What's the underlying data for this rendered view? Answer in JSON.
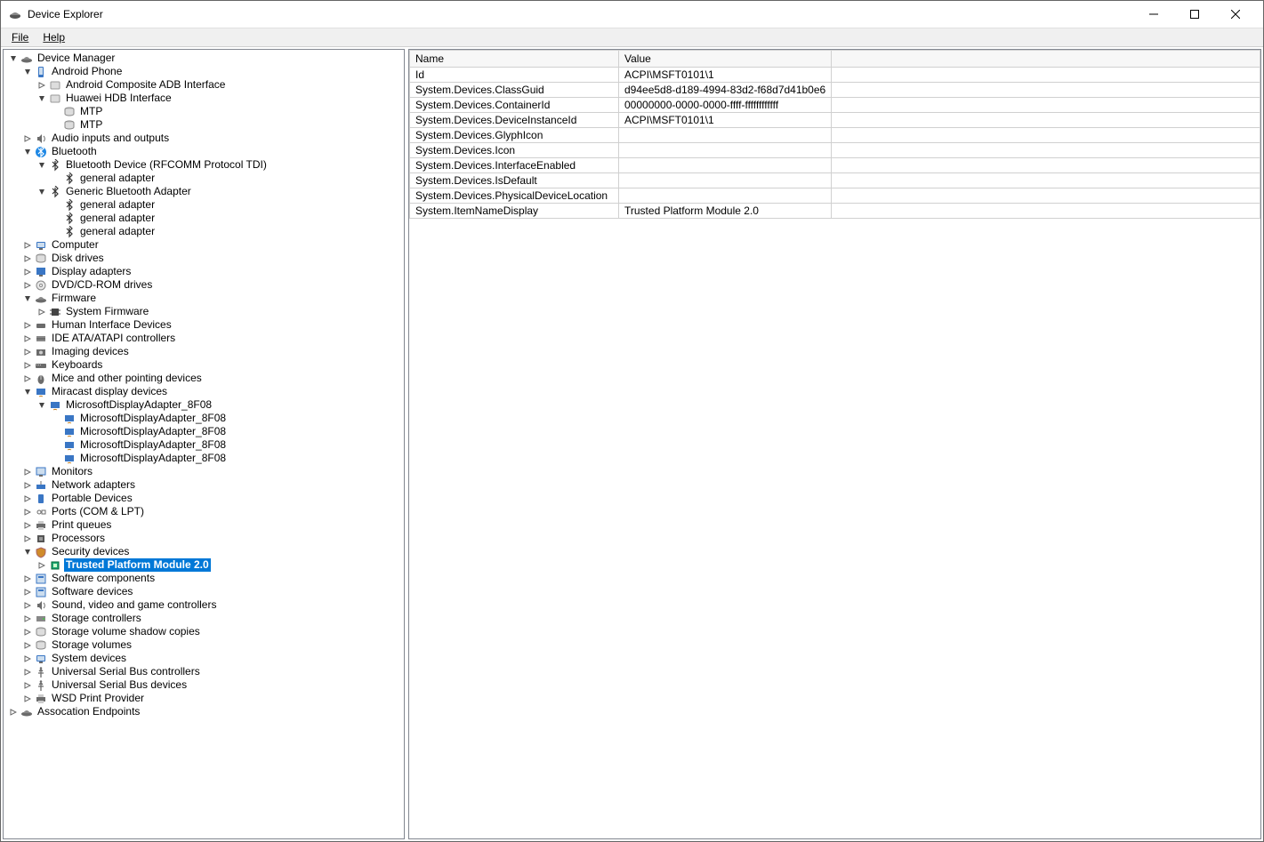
{
  "title": "Device Explorer",
  "menu": {
    "file": "File",
    "help": "Help"
  },
  "headers": {
    "name": "Name",
    "value": "Value"
  },
  "properties": [
    {
      "name": "Id",
      "value": "ACPI\\MSFT0101\\1"
    },
    {
      "name": "System.Devices.ClassGuid",
      "value": "d94ee5d8-d189-4994-83d2-f68d7d41b0e6"
    },
    {
      "name": "System.Devices.ContainerId",
      "value": "00000000-0000-0000-ffff-ffffffffffff"
    },
    {
      "name": "System.Devices.DeviceInstanceId",
      "value": "ACPI\\MSFT0101\\1"
    },
    {
      "name": "System.Devices.GlyphIcon",
      "value": ""
    },
    {
      "name": "System.Devices.Icon",
      "value": ""
    },
    {
      "name": "System.Devices.InterfaceEnabled",
      "value": ""
    },
    {
      "name": "System.Devices.IsDefault",
      "value": ""
    },
    {
      "name": "System.Devices.PhysicalDeviceLocation",
      "value": ""
    },
    {
      "name": "System.ItemNameDisplay",
      "value": "Trusted Platform Module 2.0"
    }
  ],
  "tree": [
    {
      "d": 0,
      "t": "exp",
      "i": "hat",
      "label": "Device Manager"
    },
    {
      "d": 1,
      "t": "exp",
      "i": "phone",
      "label": "Android Phone"
    },
    {
      "d": 2,
      "t": "col",
      "i": "generic",
      "label": "Android Composite ADB Interface"
    },
    {
      "d": 2,
      "t": "exp",
      "i": "generic",
      "label": "Huawei HDB Interface"
    },
    {
      "d": 3,
      "t": "none",
      "i": "disk",
      "label": "MTP"
    },
    {
      "d": 3,
      "t": "none",
      "i": "disk",
      "label": "MTP"
    },
    {
      "d": 1,
      "t": "col",
      "i": "audio",
      "label": "Audio inputs and outputs"
    },
    {
      "d": 1,
      "t": "exp",
      "i": "bt",
      "label": "Bluetooth"
    },
    {
      "d": 2,
      "t": "exp",
      "i": "btdev",
      "label": "Bluetooth Device (RFCOMM Protocol TDI)"
    },
    {
      "d": 3,
      "t": "none",
      "i": "btdev",
      "label": "general adapter"
    },
    {
      "d": 2,
      "t": "exp",
      "i": "btdev",
      "label": "Generic Bluetooth Adapter"
    },
    {
      "d": 3,
      "t": "none",
      "i": "btdev",
      "label": "general adapter"
    },
    {
      "d": 3,
      "t": "none",
      "i": "btdev",
      "label": "general adapter"
    },
    {
      "d": 3,
      "t": "none",
      "i": "btdev",
      "label": "general adapter"
    },
    {
      "d": 1,
      "t": "col",
      "i": "computer",
      "label": "Computer"
    },
    {
      "d": 1,
      "t": "col",
      "i": "disk",
      "label": "Disk drives"
    },
    {
      "d": 1,
      "t": "col",
      "i": "display",
      "label": "Display adapters"
    },
    {
      "d": 1,
      "t": "col",
      "i": "dvd",
      "label": "DVD/CD-ROM drives"
    },
    {
      "d": 1,
      "t": "exp",
      "i": "hat",
      "label": "Firmware"
    },
    {
      "d": 2,
      "t": "col",
      "i": "chip",
      "label": "System Firmware"
    },
    {
      "d": 1,
      "t": "col",
      "i": "hid",
      "label": "Human Interface Devices"
    },
    {
      "d": 1,
      "t": "col",
      "i": "ide",
      "label": "IDE ATA/ATAPI controllers"
    },
    {
      "d": 1,
      "t": "col",
      "i": "camera",
      "label": "Imaging devices"
    },
    {
      "d": 1,
      "t": "col",
      "i": "keyboard",
      "label": "Keyboards"
    },
    {
      "d": 1,
      "t": "col",
      "i": "mouse",
      "label": "Mice and other pointing devices"
    },
    {
      "d": 1,
      "t": "exp",
      "i": "miracast",
      "label": "Miracast display devices"
    },
    {
      "d": 2,
      "t": "exp",
      "i": "miracast",
      "label": "MicrosoftDisplayAdapter_8F08"
    },
    {
      "d": 3,
      "t": "none",
      "i": "miracast",
      "label": "MicrosoftDisplayAdapter_8F08"
    },
    {
      "d": 3,
      "t": "none",
      "i": "miracast",
      "label": "MicrosoftDisplayAdapter_8F08"
    },
    {
      "d": 3,
      "t": "none",
      "i": "miracast",
      "label": "MicrosoftDisplayAdapter_8F08"
    },
    {
      "d": 3,
      "t": "none",
      "i": "miracast",
      "label": "MicrosoftDisplayAdapter_8F08"
    },
    {
      "d": 1,
      "t": "col",
      "i": "monitor",
      "label": "Monitors"
    },
    {
      "d": 1,
      "t": "col",
      "i": "net",
      "label": "Network adapters"
    },
    {
      "d": 1,
      "t": "col",
      "i": "portable",
      "label": "Portable Devices"
    },
    {
      "d": 1,
      "t": "col",
      "i": "port",
      "label": "Ports (COM & LPT)"
    },
    {
      "d": 1,
      "t": "col",
      "i": "printer",
      "label": "Print queues"
    },
    {
      "d": 1,
      "t": "col",
      "i": "cpu",
      "label": "Processors"
    },
    {
      "d": 1,
      "t": "exp",
      "i": "security",
      "label": "Security devices"
    },
    {
      "d": 2,
      "t": "col",
      "i": "tpm",
      "label": "Trusted Platform Module 2.0",
      "selected": true
    },
    {
      "d": 1,
      "t": "col",
      "i": "soft",
      "label": "Software components"
    },
    {
      "d": 1,
      "t": "col",
      "i": "soft",
      "label": "Software devices"
    },
    {
      "d": 1,
      "t": "col",
      "i": "audio",
      "label": "Sound, video and game controllers"
    },
    {
      "d": 1,
      "t": "col",
      "i": "storage",
      "label": "Storage controllers"
    },
    {
      "d": 1,
      "t": "col",
      "i": "disk",
      "label": "Storage volume shadow copies"
    },
    {
      "d": 1,
      "t": "col",
      "i": "disk",
      "label": "Storage volumes"
    },
    {
      "d": 1,
      "t": "col",
      "i": "computer",
      "label": "System devices"
    },
    {
      "d": 1,
      "t": "col",
      "i": "usb",
      "label": "Universal Serial Bus controllers"
    },
    {
      "d": 1,
      "t": "col",
      "i": "usb",
      "label": "Universal Serial Bus devices"
    },
    {
      "d": 1,
      "t": "col",
      "i": "printer",
      "label": "WSD Print Provider"
    },
    {
      "d": 0,
      "t": "col",
      "i": "hat",
      "label": "Assocation Endpoints"
    }
  ]
}
